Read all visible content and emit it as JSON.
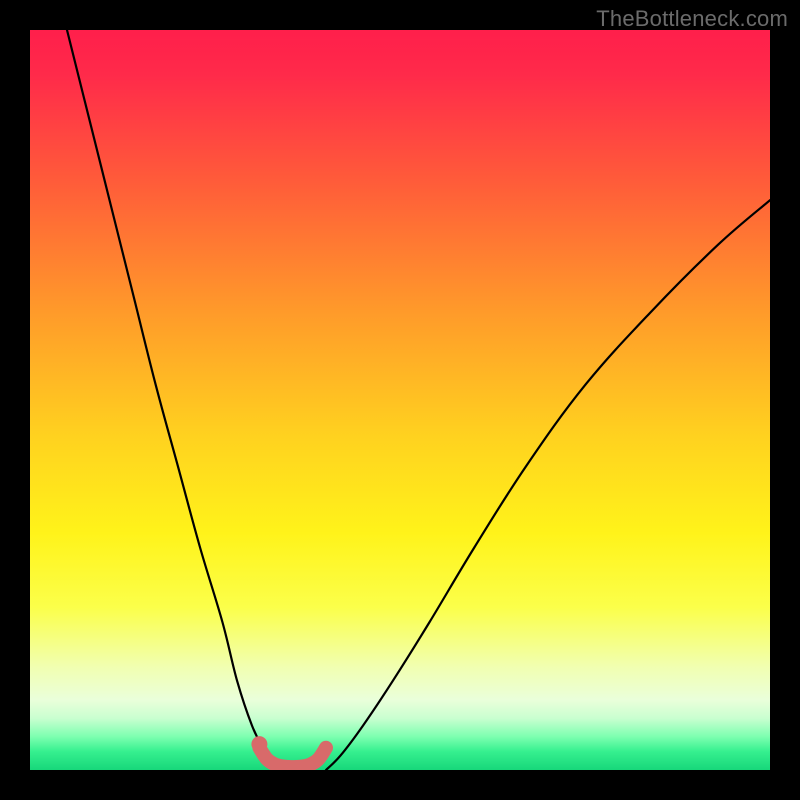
{
  "watermark": "TheBottleneck.com",
  "chart_data": {
    "type": "line",
    "title": "",
    "xlabel": "",
    "ylabel": "",
    "xlim": [
      0,
      100
    ],
    "ylim": [
      0,
      100
    ],
    "series": [
      {
        "name": "left-curve",
        "x": [
          5,
          8,
          11,
          14,
          17,
          20,
          23,
          26,
          28,
          30,
          31.5,
          33,
          34
        ],
        "y": [
          100,
          88,
          76,
          64,
          52,
          41,
          30,
          20,
          12,
          6,
          3,
          1,
          0
        ]
      },
      {
        "name": "right-curve",
        "x": [
          40,
          42,
          45,
          49,
          54,
          60,
          67,
          75,
          84,
          93,
          100
        ],
        "y": [
          0,
          2,
          6,
          12,
          20,
          30,
          41,
          52,
          62,
          71,
          77
        ]
      },
      {
        "name": "valley-marker",
        "x": [
          31,
          32,
          33,
          34,
          35,
          36,
          37,
          38,
          39,
          40
        ],
        "y": [
          3,
          1.5,
          0.8,
          0.5,
          0.4,
          0.4,
          0.5,
          0.8,
          1.5,
          3
        ]
      }
    ],
    "annotations": [
      {
        "name": "left-dot",
        "x": 31,
        "y": 3.5
      }
    ],
    "gradient_stops": [
      {
        "offset": 0.0,
        "color": "#ff1f4b"
      },
      {
        "offset": 0.06,
        "color": "#ff2a4a"
      },
      {
        "offset": 0.2,
        "color": "#ff5a3a"
      },
      {
        "offset": 0.38,
        "color": "#ff9a2a"
      },
      {
        "offset": 0.55,
        "color": "#ffd21f"
      },
      {
        "offset": 0.68,
        "color": "#fff31a"
      },
      {
        "offset": 0.78,
        "color": "#fbff4a"
      },
      {
        "offset": 0.86,
        "color": "#f1ffb0"
      },
      {
        "offset": 0.905,
        "color": "#eaffda"
      },
      {
        "offset": 0.93,
        "color": "#c9ffd0"
      },
      {
        "offset": 0.955,
        "color": "#7dffb0"
      },
      {
        "offset": 0.975,
        "color": "#36f08f"
      },
      {
        "offset": 1.0,
        "color": "#17d77a"
      }
    ],
    "colors": {
      "curve": "#000000",
      "marker": "#d86a6a",
      "background_frame": "#000000"
    }
  }
}
